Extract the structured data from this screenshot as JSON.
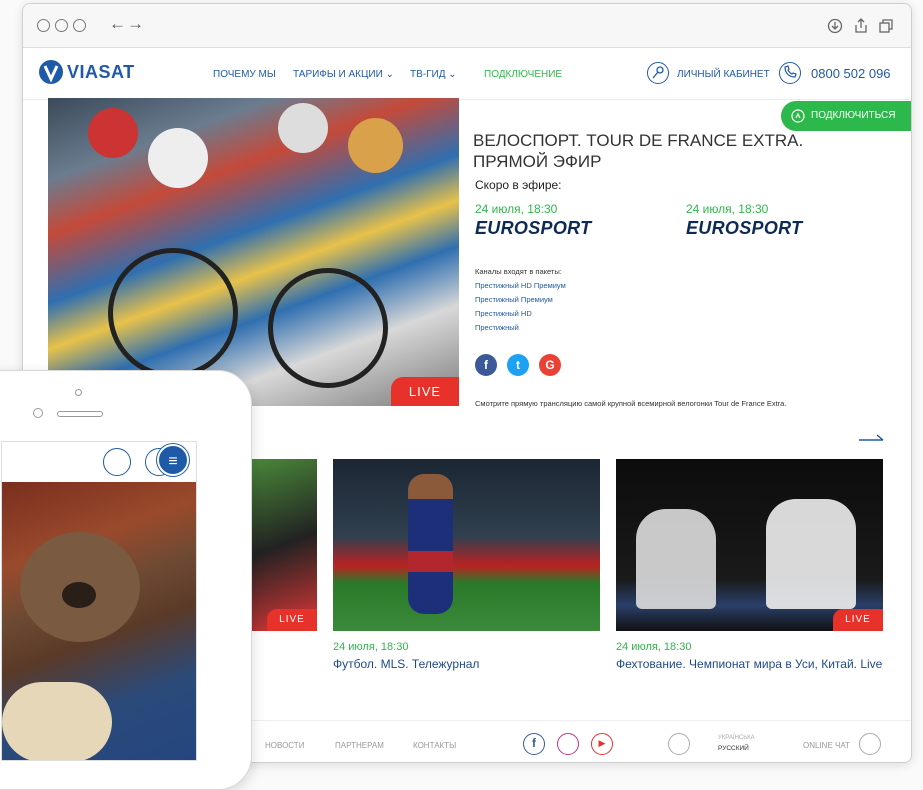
{
  "browser": {
    "controls": [
      "back-arrow",
      "forward-arrow"
    ],
    "toolbar_icons": [
      "download-icon",
      "share-icon",
      "tabs-icon"
    ]
  },
  "header": {
    "logo": "VIASAT",
    "nav": [
      {
        "label": "ПОЧЕМУ МЫ",
        "dropdown": false
      },
      {
        "label": "ТАРИФЫ И АКЦИИ",
        "dropdown": true
      },
      {
        "label": "ТВ-ГИД",
        "dropdown": true
      },
      {
        "label": "ПОДКЛЮЧЕНИЕ",
        "dropdown": false
      }
    ],
    "cabinet_label": "ЛИЧНЫЙ КАБИНЕТ",
    "phone": "0800 502 096"
  },
  "connect_button": "ПОДКЛЮЧИТЬСЯ",
  "hero": {
    "title_line1": "ВЕЛОСПОРТ. TOUR DE FRANCE EXTRA.",
    "title_line2": "ПРЯМОЙ ЭФИР",
    "live_label": "LIVE",
    "soon_label": "Скоро в эфире:",
    "airings": [
      {
        "date": "24 июля, 18:30",
        "channel": "EUROSPORT"
      },
      {
        "date": "24 июля, 18:30",
        "channel": "EUROSPORT"
      }
    ],
    "packages_label": "Каналы входят в пакеты:",
    "packages": [
      "Престижный HD Премиум",
      "Престижный Премиум",
      "Престижный HD",
      "Престижный"
    ],
    "description": "Смотрите прямую трансляцию самой крупной всемирной велогонки Tour de France Extra."
  },
  "cards": [
    {
      "live": "LIVE",
      "date": "",
      "title": ""
    },
    {
      "live": "",
      "date": "24 июля, 18:30",
      "title": "Футбол. MLS. Тележурнал"
    },
    {
      "live": "LIVE",
      "date": "24 июля, 18:30",
      "title": "Фехтование. Чемпионат мира в Уси, Китай. Live"
    }
  ],
  "footer": {
    "links": [
      "НОВОСТИ",
      "ПАРТНЕРАМ",
      "КОНТАКТЫ"
    ],
    "languages": [
      "УКРАЇНСЬКА",
      "РУССКИЙ"
    ],
    "chat": "ONLINE ЧАТ"
  },
  "colors": {
    "brand_blue": "#1f5aa8",
    "green": "#2db84b",
    "live_red": "#e7312b",
    "eurosport_navy": "#0d2a55"
  }
}
